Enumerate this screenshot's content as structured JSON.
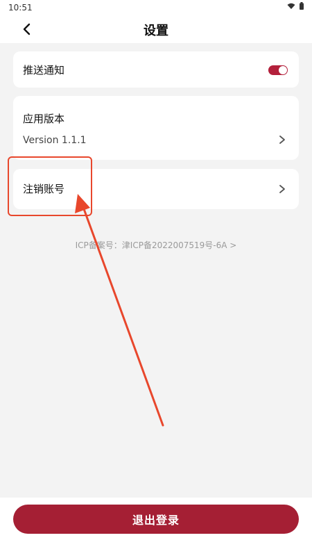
{
  "status_bar": {
    "time": "10:51",
    "icons": [
      "wifi-icon",
      "battery-icon"
    ]
  },
  "header": {
    "title": "设置",
    "back_icon": "back-arrow-icon"
  },
  "settings": {
    "push_notification": {
      "label": "推送通知",
      "enabled": true
    },
    "app_version": {
      "label": "应用版本",
      "value": "Version 1.1.1"
    },
    "delete_account": {
      "label": "注销账号"
    }
  },
  "icp": {
    "text": "ICP备案号：津ICP备2022007519号-6A >"
  },
  "footer": {
    "logout_label": "退出登录"
  },
  "colors": {
    "accent": "#a51f34",
    "annotation": "#e8472c",
    "background": "#f3f3f3"
  }
}
